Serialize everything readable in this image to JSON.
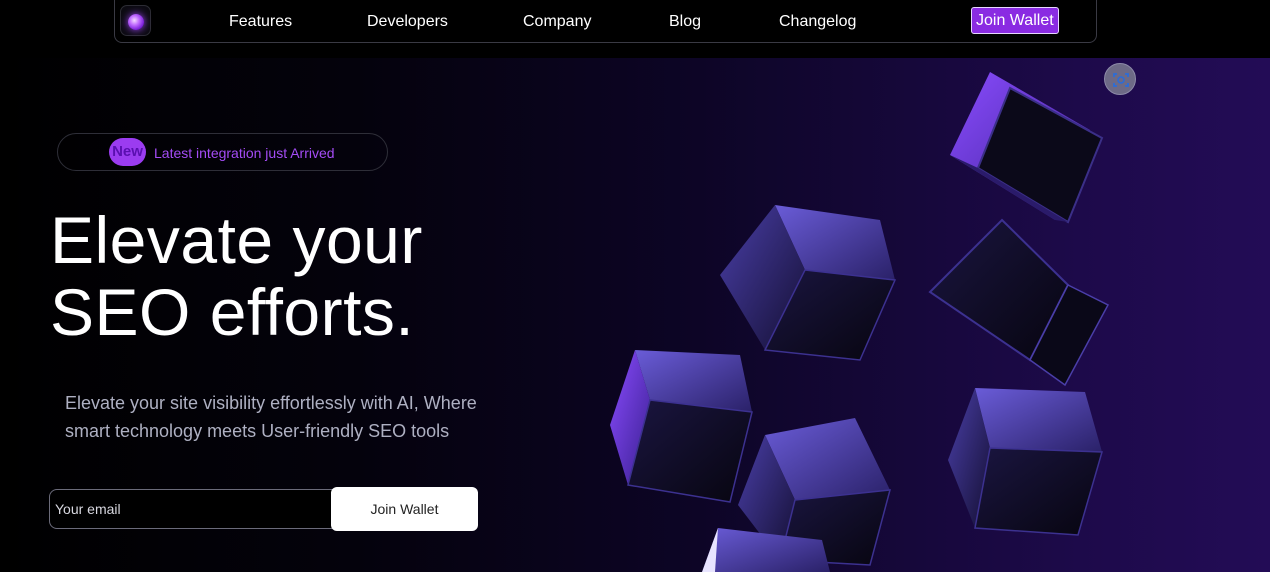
{
  "nav": {
    "links": [
      "Features",
      "Developers",
      "Company",
      "Blog",
      "Changelog"
    ],
    "cta": "Join Wallet"
  },
  "hero": {
    "badge_tag": "New",
    "badge_text": "Latest integration just Arrived",
    "title_line1": "Elevate your",
    "title_line2": "SEO efforts.",
    "subtitle_line1": "Elevate your site visibility effortlessly with AI, Where",
    "subtitle_line2": "smart technology meets User-friendly SEO tools",
    "email_placeholder": "Your email",
    "join_label": "Join Wallet"
  },
  "icons": {
    "logo": "purple-orb-logo-icon",
    "scan": "scan-icon"
  },
  "colors": {
    "accent": "#8a2be2",
    "badge_text": "#a44cf5",
    "hero_right": "#230c56"
  }
}
